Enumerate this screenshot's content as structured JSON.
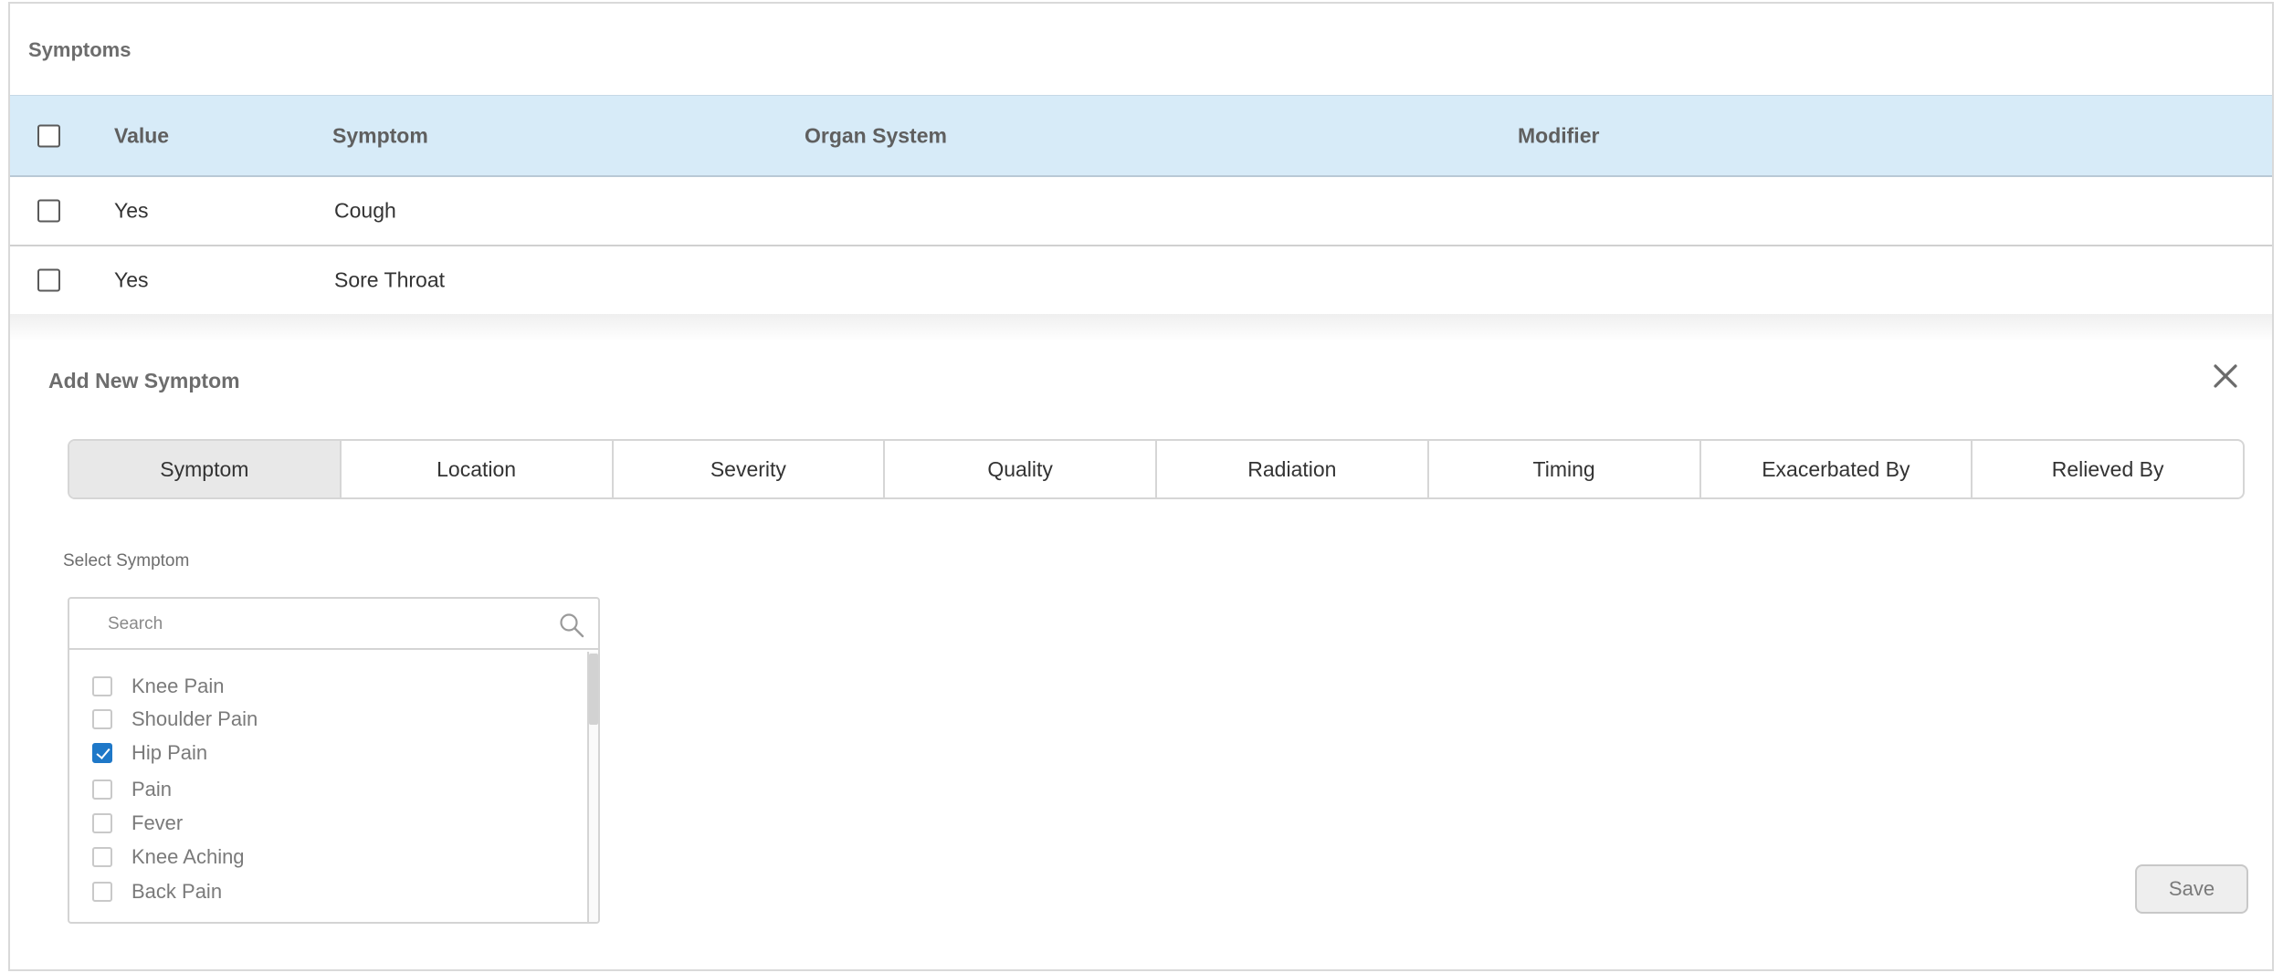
{
  "symptoms_section": {
    "title": "Symptoms",
    "columns": {
      "value": "Value",
      "symptom": "Symptom",
      "organ_system": "Organ System",
      "modifier": "Modifier"
    },
    "rows": [
      {
        "value": "Yes",
        "symptom": "Cough",
        "organ_system": "",
        "modifier": ""
      },
      {
        "value": "Yes",
        "symptom": "Sore Throat",
        "organ_system": "",
        "modifier": ""
      }
    ]
  },
  "add_panel": {
    "title": "Add New Symptom",
    "close_icon": "close-icon",
    "tabs": [
      {
        "label": "Symptom",
        "active": true
      },
      {
        "label": "Location",
        "active": false
      },
      {
        "label": "Severity",
        "active": false
      },
      {
        "label": "Quality",
        "active": false
      },
      {
        "label": "Radiation",
        "active": false
      },
      {
        "label": "Timing",
        "active": false
      },
      {
        "label": "Exacerbated By",
        "active": false
      },
      {
        "label": "Relieved By",
        "active": false
      }
    ],
    "select_label": "Select Symptom",
    "search": {
      "placeholder": "Search",
      "value": "",
      "icon": "search-icon"
    },
    "options": [
      {
        "label": "Knee Pain",
        "checked": false
      },
      {
        "label": "Shoulder Pain",
        "checked": false
      },
      {
        "label": "Hip Pain",
        "checked": true
      },
      {
        "label": "Pain",
        "checked": false
      },
      {
        "label": "Fever",
        "checked": false
      },
      {
        "label": "Knee Aching",
        "checked": false
      },
      {
        "label": "Back Pain",
        "checked": false
      }
    ],
    "save_label": "Save"
  },
  "colors": {
    "header_bg": "#d7ebf8",
    "checkbox_checked": "#1e78c8",
    "active_tab_bg": "#e8e8e8"
  }
}
